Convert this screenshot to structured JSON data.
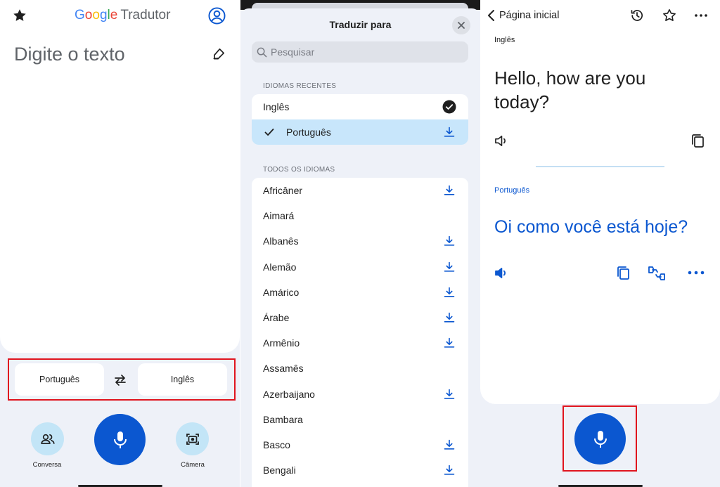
{
  "panel1": {
    "app_title": {
      "google": [
        "G",
        "o",
        "o",
        "g",
        "l",
        "e"
      ],
      "suffix": "Tradutor"
    },
    "input_placeholder": "Digite o texto",
    "source_language": "Português",
    "target_language": "Inglês",
    "conversation_label": "Conversa",
    "camera_label": "Câmera",
    "icons": [
      "star-icon",
      "account-icon",
      "handwriting-icon",
      "swap-icon",
      "conversation-icon",
      "mic-icon",
      "camera-icon"
    ]
  },
  "panel2": {
    "title": "Traduzir para",
    "search_placeholder": "Pesquisar",
    "recent_label": "IDIOMAS RECENTES",
    "recent": [
      {
        "name": "Inglês",
        "state": "current"
      },
      {
        "name": "Português",
        "state": "selected-downloaded"
      }
    ],
    "all_label": "TODOS OS IDIOMAS",
    "all": [
      {
        "name": "Africâner",
        "download": true
      },
      {
        "name": "Aimará",
        "download": false
      },
      {
        "name": "Albanês",
        "download": true
      },
      {
        "name": "Alemão",
        "download": true
      },
      {
        "name": "Amárico",
        "download": true
      },
      {
        "name": "Árabe",
        "download": true
      },
      {
        "name": "Armênio",
        "download": true
      },
      {
        "name": "Assamês",
        "download": false
      },
      {
        "name": "Azerbaijano",
        "download": true
      },
      {
        "name": "Bambara",
        "download": false
      },
      {
        "name": "Basco",
        "download": true
      },
      {
        "name": "Bengali",
        "download": true
      }
    ]
  },
  "panel3": {
    "back_label": "Página inicial",
    "source_language": "Inglês",
    "source_text": "Hello, how are you today?",
    "target_language": "Português",
    "target_text": "Oi como você está hoje?"
  },
  "colors": {
    "accent_blue": "#0b57d0",
    "highlight_red": "#e0141e",
    "selected_row": "#c8e6fb",
    "background": "#eef1f8"
  }
}
